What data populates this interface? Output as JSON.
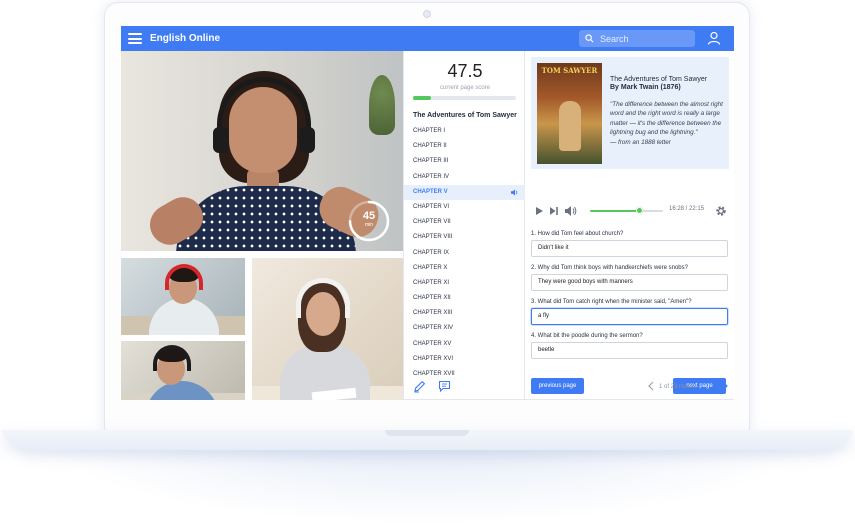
{
  "app": {
    "title": "English Online"
  },
  "search": {
    "placeholder": "Search"
  },
  "session": {
    "timer_value": "45",
    "timer_unit": "min"
  },
  "score": {
    "value": "47.5",
    "label": "current page score",
    "progress_percent": 17
  },
  "book": {
    "heading": "The Adventures of Tom Sawyer",
    "chapters": [
      {
        "label": "CHAPTER I",
        "active": false
      },
      {
        "label": "CHAPTER II",
        "active": false
      },
      {
        "label": "CHAPTER III",
        "active": false
      },
      {
        "label": "CHAPTER IV",
        "active": false
      },
      {
        "label": "CHAPTER V",
        "active": true
      },
      {
        "label": "CHAPTER VI",
        "active": false
      },
      {
        "label": "CHAPTER VII",
        "active": false
      },
      {
        "label": "CHAPTER VIII",
        "active": false
      },
      {
        "label": "CHAPTER IX",
        "active": false
      },
      {
        "label": "CHAPTER X",
        "active": false
      },
      {
        "label": "CHAPTER XI",
        "active": false
      },
      {
        "label": "CHAPTER XII",
        "active": false
      },
      {
        "label": "CHAPTER XIII",
        "active": false
      },
      {
        "label": "CHAPTER XIV",
        "active": false
      },
      {
        "label": "CHAPTER XV",
        "active": false
      },
      {
        "label": "CHAPTER XVI",
        "active": false
      },
      {
        "label": "CHAPTER XVII",
        "active": false
      }
    ]
  },
  "card": {
    "cover_title": "TOM SAWYER",
    "title": "The Adventures of Tom Sawyer",
    "author": "By Mark Twain (1876)",
    "quote": "\"The difference between the almost right word and the right word is really a large matter — it's the difference between the lightning bug and the lightning.\"",
    "source": "— from an 1888 letter"
  },
  "player": {
    "time": "16:28 / 22:15",
    "progress_percent": 67
  },
  "questions": [
    {
      "label": "1. How did Tom feel about church?",
      "answer": "Didn't like it"
    },
    {
      "label": "2. Why did Tom think boys with handkerchiefs were snobs?",
      "answer": "They were good boys with manners"
    },
    {
      "label": "3. What did Tom catch right when the minister said, \"Amen\"?",
      "answer": "a fly"
    },
    {
      "label": "4. What bit the poodle during the sermon?",
      "answer": "beetle"
    }
  ],
  "buttons": {
    "previous": "previous page",
    "next": "next page"
  },
  "pager": {
    "text": "1 of 23 rooms"
  },
  "colors": {
    "brand": "#3f7cf4",
    "progress": "#55c85a",
    "active_row": "#e7effd",
    "card_bg": "#e8f0fc"
  }
}
